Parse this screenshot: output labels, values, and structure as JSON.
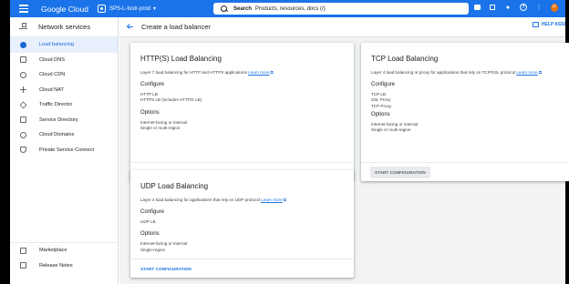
{
  "topbar": {
    "brand": "Google Cloud",
    "project": "SPS-L-fostr-prod",
    "search_label": "Search",
    "search_hint": "Products, resources, docs (/)",
    "avatar_letter": "P"
  },
  "sidebar": {
    "title": "Network services",
    "items": [
      {
        "label": "Load balancing"
      },
      {
        "label": "Cloud DNS"
      },
      {
        "label": "Cloud CDN"
      },
      {
        "label": "Cloud NAT"
      },
      {
        "label": "Traffic Director"
      },
      {
        "label": "Service Directory"
      },
      {
        "label": "Cloud Domains"
      },
      {
        "label": "Private Service Connect"
      }
    ],
    "footer_items": [
      {
        "label": "Marketplace"
      },
      {
        "label": "Release Notes"
      }
    ]
  },
  "main": {
    "title": "Create a load balancer",
    "help_label": "HELP ASSI"
  },
  "cards": {
    "http": {
      "title": "HTTP(S) Load Balancing",
      "desc": "Layer 7 load balancing for HTTP and HTTPS applications",
      "learn_more": "Learn more",
      "configure_heading": "Configure",
      "configure_lines": [
        "HTTP LB",
        "HTTPS LB (includes HTTP/2 LB)"
      ],
      "options_heading": "Options",
      "options_lines": [
        "Internet-facing or internal",
        "Single or multi-region"
      ],
      "button": "START CONFIGURATION"
    },
    "tcp": {
      "title": "TCP Load Balancing",
      "desc": "Layer 4 load balancing or proxy for applications that rely on TCP/SSL protocol",
      "learn_more": "Learn more",
      "configure_heading": "Configure",
      "configure_lines": [
        "TCP LB",
        "SSL Proxy",
        "TCP Proxy"
      ],
      "options_heading": "Options",
      "options_lines": [
        "Internet-facing or internal",
        "Single or multi-region"
      ],
      "button": "START CONFIGURATION"
    },
    "udp": {
      "title": "UDP Load Balancing",
      "desc": "Layer 4 load balancing for applications that rely on UDP protocol",
      "learn_more": "Learn more",
      "configure_heading": "Configure",
      "configure_lines": [
        "UDP LB"
      ],
      "options_heading": "Options",
      "options_lines": [
        "Internet-facing or internal",
        "Single-region"
      ],
      "button": "START CONFIGURATION"
    }
  },
  "colors": {
    "accent": "#1a73e8",
    "active_bg": "#e8f0fe",
    "page_bg": "#f1f3f4"
  }
}
